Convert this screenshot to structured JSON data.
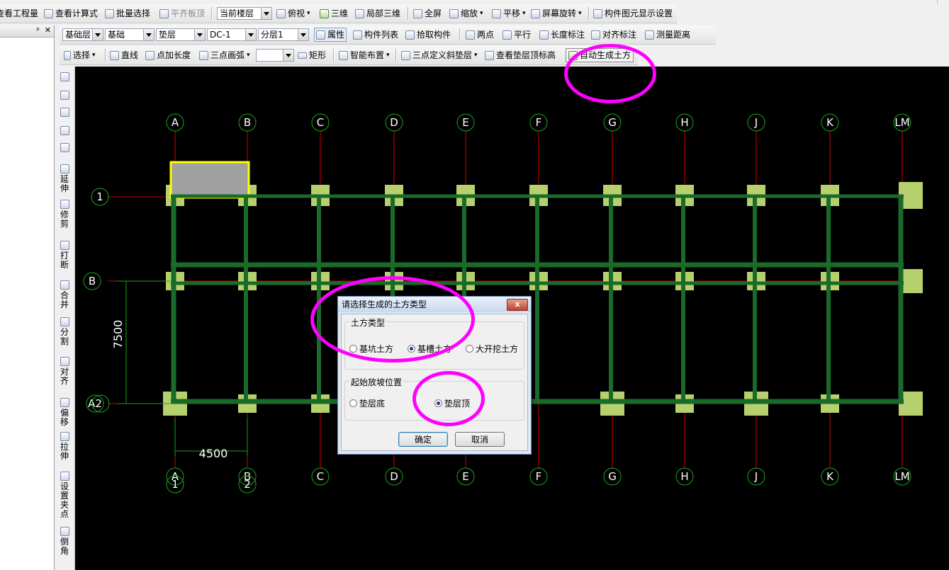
{
  "toolbar1": {
    "view_quantity": "查看工程量",
    "view_formula": "查看计算式",
    "batch_select": "批量选择",
    "align_slab_top": "平齐板顶",
    "floor_select": "当前楼层",
    "top_view": "俯视",
    "three_d": "三维",
    "partial_3d": "局部三维",
    "full_screen": "全屏",
    "zoom": "缩放",
    "pan": "平移",
    "rotate_screen": "屏幕旋转",
    "display_settings": "构件图元显示设置"
  },
  "toolbar2": {
    "floor_value": "基础层",
    "category_value": "基础",
    "type_value": "垫层",
    "component_value": "DC-1",
    "sublayer_value": "分层1",
    "properties": "属性",
    "component_list": "构件列表",
    "pick_component": "拾取构件",
    "two_points": "两点",
    "parallel": "平行",
    "length_dim": "长度标注",
    "aligned_dim": "对齐标注",
    "measure_distance": "测量距离"
  },
  "toolbar3": {
    "select": "选择",
    "line": "直线",
    "point_length": "点加长度",
    "three_point_arc": "三点画弧",
    "arc_value": "",
    "rectangle": "矩形",
    "smart_layout": "智能布置",
    "three_point_slope": "三点定义斜垫层",
    "view_cushion_top": "查看垫层顶标高",
    "auto_generate_earthwork": "自动生成土方"
  },
  "left_tools": [
    {
      "label": "",
      "icon": "brush-icon"
    },
    {
      "label": "",
      "icon": "copy-icon"
    },
    {
      "label": "",
      "icon": "mirror-icon"
    },
    {
      "label": "",
      "icon": "move-icon"
    },
    {
      "label": "",
      "icon": "rotate-icon"
    },
    {
      "label": "延伸",
      "icon": "extend-icon"
    },
    {
      "label": "修剪",
      "icon": "trim-icon"
    },
    {
      "label": "打断",
      "icon": "break-icon"
    },
    {
      "label": "合并",
      "icon": "merge-icon"
    },
    {
      "label": "分割",
      "icon": "split-icon"
    },
    {
      "label": "对齐",
      "icon": "align-icon"
    },
    {
      "label": "偏移",
      "icon": "offset-icon"
    },
    {
      "label": "拉伸",
      "icon": "stretch-icon"
    },
    {
      "label": "设置夹点",
      "icon": "grip-icon"
    },
    {
      "label": "倒角",
      "icon": "chamfer-icon"
    }
  ],
  "axes": {
    "top": [
      "A",
      "B",
      "C",
      "D",
      "E",
      "F",
      "G",
      "H",
      "J",
      "K",
      "LM"
    ],
    "bottom": [
      "A",
      "B",
      "C",
      "D",
      "E",
      "F",
      "G",
      "H",
      "J",
      "K",
      "LM"
    ],
    "bottom_sub": [
      "1",
      "2"
    ],
    "left": [
      "1",
      "B",
      "A2"
    ],
    "dim_horizontal": "4500",
    "dim_vertical": "7500"
  },
  "dialog": {
    "title": "请选择生成的土方类型",
    "close_label": "x",
    "group1_label": "土方类型",
    "opt_pit": "基坑土方",
    "opt_trench": "基槽土方",
    "opt_open": "大开挖土方",
    "group2_label": "起始放坡位置",
    "opt_bottom": "垫层底",
    "opt_top": "垫层顶",
    "ok": "确定",
    "cancel": "取消",
    "selected_type": "基槽土方",
    "selected_slope_start": "垫层顶"
  },
  "colors": {
    "grid_line": "#d00000",
    "axis_circle": "#1aa51a",
    "beam": "#1a6a2a",
    "pad": "#b6d06e",
    "selected_outline": "#ffff00",
    "highlight": "#ff00ff",
    "canvas_bg": "#000000"
  }
}
